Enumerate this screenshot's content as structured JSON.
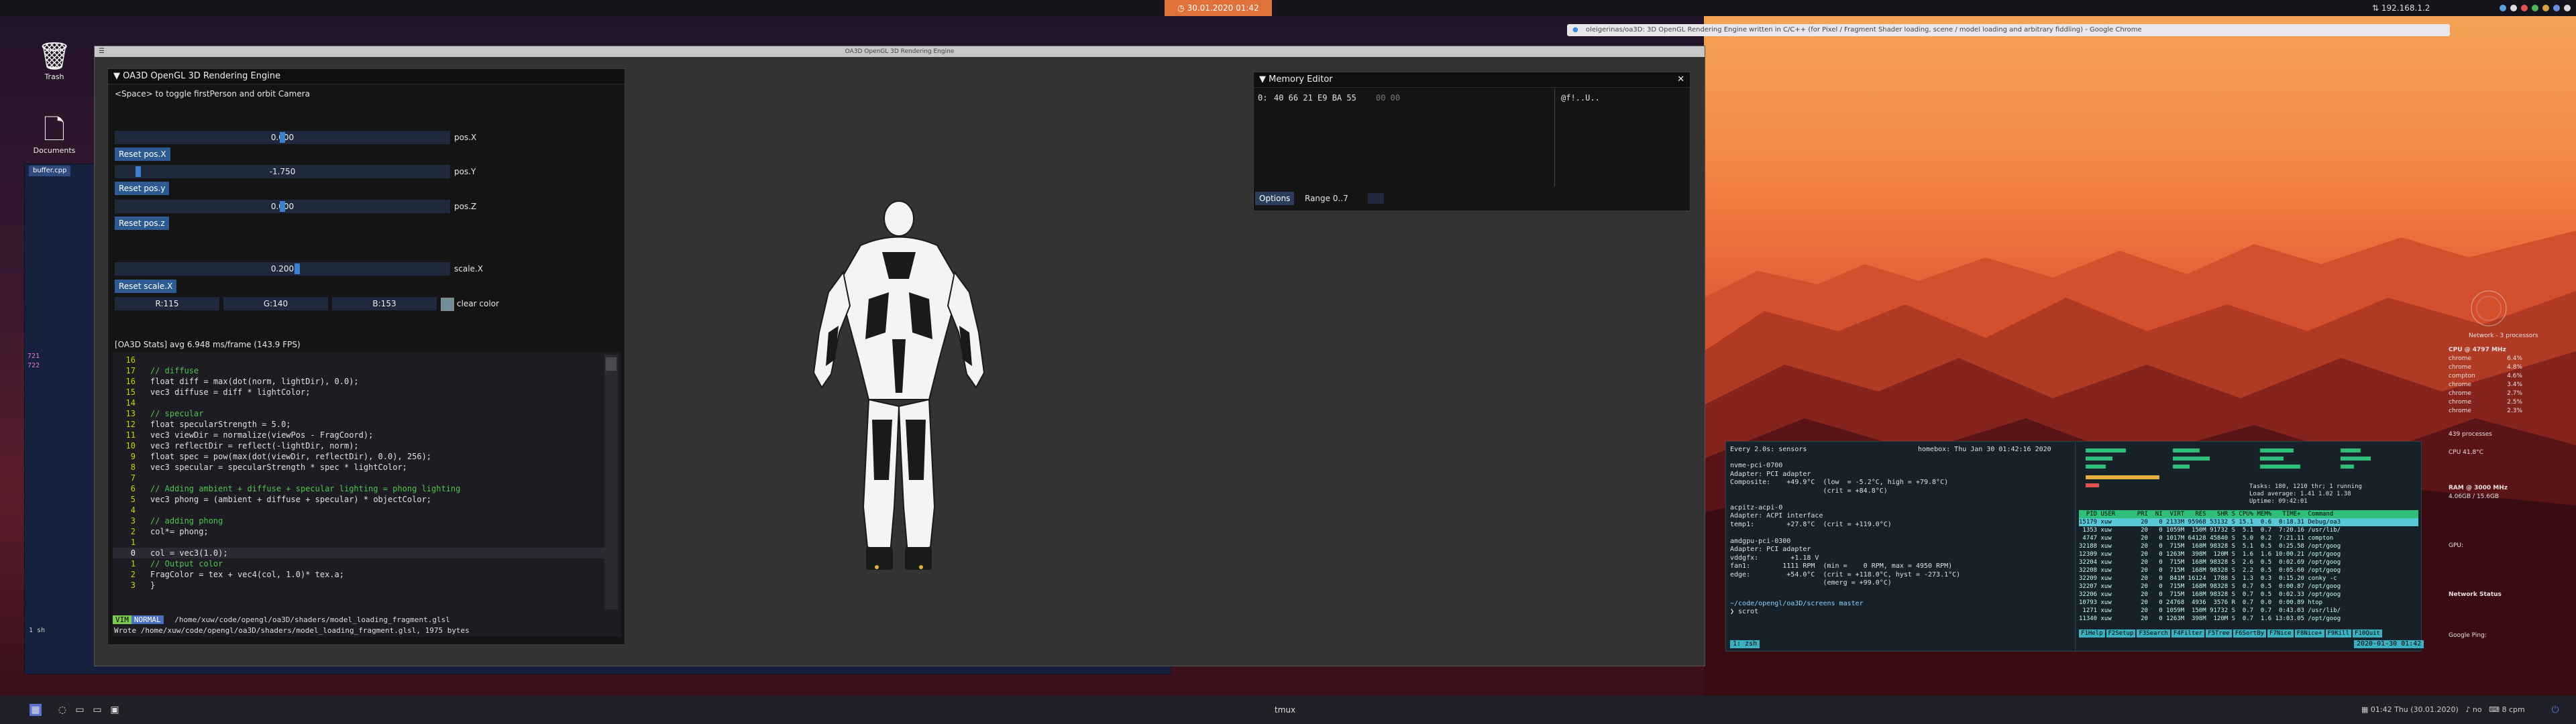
{
  "topbar": {
    "clock": "30.01.2020 01:42",
    "ip": "192.168.1.2"
  },
  "desktop": {
    "icons": [
      {
        "label": "Trash",
        "icon": "trash-icon"
      },
      {
        "label": "Documents",
        "icon": "document-icon"
      }
    ]
  },
  "chrome": {
    "title": "oleigerinas/oa3D: 3D OpenGL Rendering Engine written in C/C++ (for Pixel / Fragment Shader loading, scene / model loading and arbitrary fiddling) - Google Chrome"
  },
  "editor": {
    "tab": "buffer.cpp",
    "gutter_numbers": [
      "721",
      "722"
    ],
    "status": "1 sh"
  },
  "glwin": {
    "title": "OA3D OpenGL 3D Rendering Engine"
  },
  "engine_panel": {
    "title": "OA3D OpenGL 3D Rendering Engine",
    "hint": "<Space> to toggle firstPerson and orbit Camera",
    "sliders": [
      {
        "value": "0.000",
        "label": "pos.X",
        "button": "Reset pos.X"
      },
      {
        "value": "-1.750",
        "label": "pos.Y",
        "button": "Reset pos.y"
      },
      {
        "value": "0.000",
        "label": "pos.Z",
        "button": "Reset pos.z"
      },
      {
        "value": "0.200",
        "label": "scale.X",
        "button": "Reset scale.X"
      }
    ],
    "slider_fractions": [
      0.5,
      0.0625,
      0.5,
      0.545
    ],
    "color": {
      "r": "R:115",
      "g": "G:140",
      "b": "B:153",
      "label": "clear color",
      "swatch": "#738c99"
    },
    "stats": "[OA3D Stats] avg 6.948 ms/frame (143.9 FPS)"
  },
  "vim": {
    "lines": [
      {
        "ln": "16",
        "kind": "code",
        "text": ""
      },
      {
        "ln": "17",
        "kind": "comment",
        "text": "// diffuse"
      },
      {
        "ln": "16",
        "kind": "code",
        "text": "float diff = max(dot(norm, lightDir), 0.0);"
      },
      {
        "ln": "15",
        "kind": "code",
        "text": "vec3 diffuse = diff * lightColor;"
      },
      {
        "ln": "14",
        "kind": "code",
        "text": ""
      },
      {
        "ln": "13",
        "kind": "comment",
        "text": "// specular"
      },
      {
        "ln": "12",
        "kind": "code",
        "text": "float specularStrength = 5.0;"
      },
      {
        "ln": "11",
        "kind": "code",
        "text": "vec3 viewDir = normalize(viewPos - FragCoord);"
      },
      {
        "ln": "10",
        "kind": "code",
        "text": "vec3 reflectDir = reflect(-lightDir, norm);"
      },
      {
        "ln": "9",
        "kind": "code",
        "text": "float spec = pow(max(dot(viewDir, reflectDir), 0.0), 256);"
      },
      {
        "ln": "8",
        "kind": "code",
        "text": "vec3 specular = specularStrength * spec * lightColor;"
      },
      {
        "ln": "7",
        "kind": "code",
        "text": ""
      },
      {
        "ln": "6",
        "kind": "comment",
        "text": "// Adding ambient + diffuse + specular lighting = phong lighting"
      },
      {
        "ln": "5",
        "kind": "code",
        "text": "vec3 phong = (ambient + diffuse + specular) * objectColor;"
      },
      {
        "ln": "4",
        "kind": "code",
        "text": ""
      },
      {
        "ln": "3",
        "kind": "comment",
        "text": "// adding phong"
      },
      {
        "ln": "2",
        "kind": "code",
        "text": "col*= phong;"
      },
      {
        "ln": "1",
        "kind": "code",
        "text": ""
      },
      {
        "ln": "0",
        "kind": "code",
        "text": "col = vec3(1.0);"
      },
      {
        "ln": "1",
        "kind": "comment",
        "text": "// Output color"
      },
      {
        "ln": "2",
        "kind": "code",
        "text": "FragColor = tex + vec4(col, 1.0)* tex.a;"
      },
      {
        "ln": "3",
        "kind": "code",
        "text": "}"
      }
    ],
    "mode1": "VIM",
    "mode2": "NORMAL",
    "path": "/home/xuw/code/opengl/oa3D/shaders/model_loading_fragment.glsl",
    "message": "Wrote /home/xuw/code/opengl/oa3D/shaders/model_loading_fragment.glsl, 1975 bytes"
  },
  "memory_editor": {
    "title": "Memory Editor",
    "address": "0:",
    "bytes": "40 66 21 E9 BA 55",
    "bytes_zero": "00 00",
    "ascii": "@f!..U..",
    "options_button": "Options",
    "range": "Range 0..7"
  },
  "terminal": {
    "header_left": "Every 2.0s: sensors",
    "header_right": "homebox: Thu Jan 30 01:42:16 2020",
    "sensors": [
      "nvme-pci-0700",
      "Adapter: PCI adapter",
      "Composite:    +49.9°C  (low  = -5.2°C, high = +79.8°C)",
      "                       (crit = +84.8°C)",
      "",
      "acpitz-acpi-0",
      "Adapter: ACPI interface",
      "temp1:        +27.8°C  (crit = +119.0°C)",
      "",
      "amdgpu-pci-0300",
      "Adapter: PCI adapter",
      "vddgfx:        +1.18 V",
      "fan1:        1111 RPM  (min =    0 RPM, max = 4950 RPM)",
      "edge:         +54.0°C  (crit = +118.0°C, hyst = -273.1°C)",
      "                       (emerg = +99.0°C)"
    ],
    "prompt": "~/code/opengl/oa3D/screens master",
    "cmd": "❯ scrot",
    "pane_status": "1: zsh",
    "htop_summary": [
      "Tasks: 180, 1210 thr; 1 running",
      "Load average: 1.41 1.02 1.38",
      "Uptime: 09:42:01"
    ],
    "htop_header": "  PID USER      PRI  NI  VIRT   RES   SHR S CPU% MEM%   TIME+  Command",
    "htop_rows": [
      "15179 xuw        20   0 2133M 95968 53132 S 15.1  0.6  0:18.31 Debug/oa3",
      " 1353 xuw        20   0 1059M  150M 91732 S  5.1  0.7  7:20.16 /usr/lib/",
      " 4747 xuw        20   0 1017M 64128 45840 S  5.0  0.2  7:21.11 compton",
      "32188 xuw        20   0  715M  168M 98328 S  5.1  0.5  0:25.58 /opt/goog",
      "12309 xuw        20   0 1263M  398M  120M S  1.6  1.6 10:00.21 /opt/goog",
      "32204 xuw        20   0  715M  168M 98328 S  2.6  0.5  0:02.69 /opt/goog",
      "32208 xuw        20   0  715M  168M 98328 S  2.2  0.5  0:05.60 /opt/goog",
      "32209 xuw        20   0  841M 16124  1788 S  1.3  0.3  0:15.20 conky -c",
      "32207 xuw        20   0  715M  168M 98328 S  0.7  0.5  0:00.87 /opt/goog",
      "32206 xuw        20   0  715M  168M 98328 S  0.7  0.5  0:02.33 /opt/goog",
      "10793 xuw        20   0 24768  4936  3576 R  0.7  0.0  0:00.89 htop",
      " 1271 xuw        20   0 1059M  150M 91732 S  0.7  0.7  0:43.03 /usr/lib/",
      "11340 xuw        20   0 1263M  398M  120M S  0.7  1.6 13:03.05 /opt/goog"
    ],
    "fkeys": [
      "F1Help",
      "F2Setup",
      "F3Search",
      "F4Filter",
      "F5Tree",
      "F6SortBy",
      "F7Nice",
      "F8Nice+",
      "F9Kill",
      "F10Quit"
    ],
    "tmux_right": "2020-01-30 01:42"
  },
  "conky": {
    "header": "Network  - 3 processors",
    "cpu_label": "CPU @ 4797 MHz",
    "procs": [
      "chrome",
      "chrome",
      "compton",
      "chrome",
      "chrome",
      "chrome",
      "chrome"
    ],
    "cpu_vals": [
      "6.4%",
      "4.8%",
      "4.6%",
      "3.4%",
      "2.7%",
      "2.5%",
      "2.3%"
    ],
    "processes": "439 processes",
    "cpu_temp": "CPU 41.8°C",
    "ram_label": "RAM @ 3000 MHz",
    "ram_usage": "4.06GB / 15.6GB",
    "gpu_label": "GPU:",
    "network": "Network Status",
    "google": "Google Ping:"
  },
  "taskbar": {
    "title": "tmux",
    "right": "01:42 Thu (30.01.2020)",
    "volume": "no",
    "cpm": "8 cpm"
  }
}
